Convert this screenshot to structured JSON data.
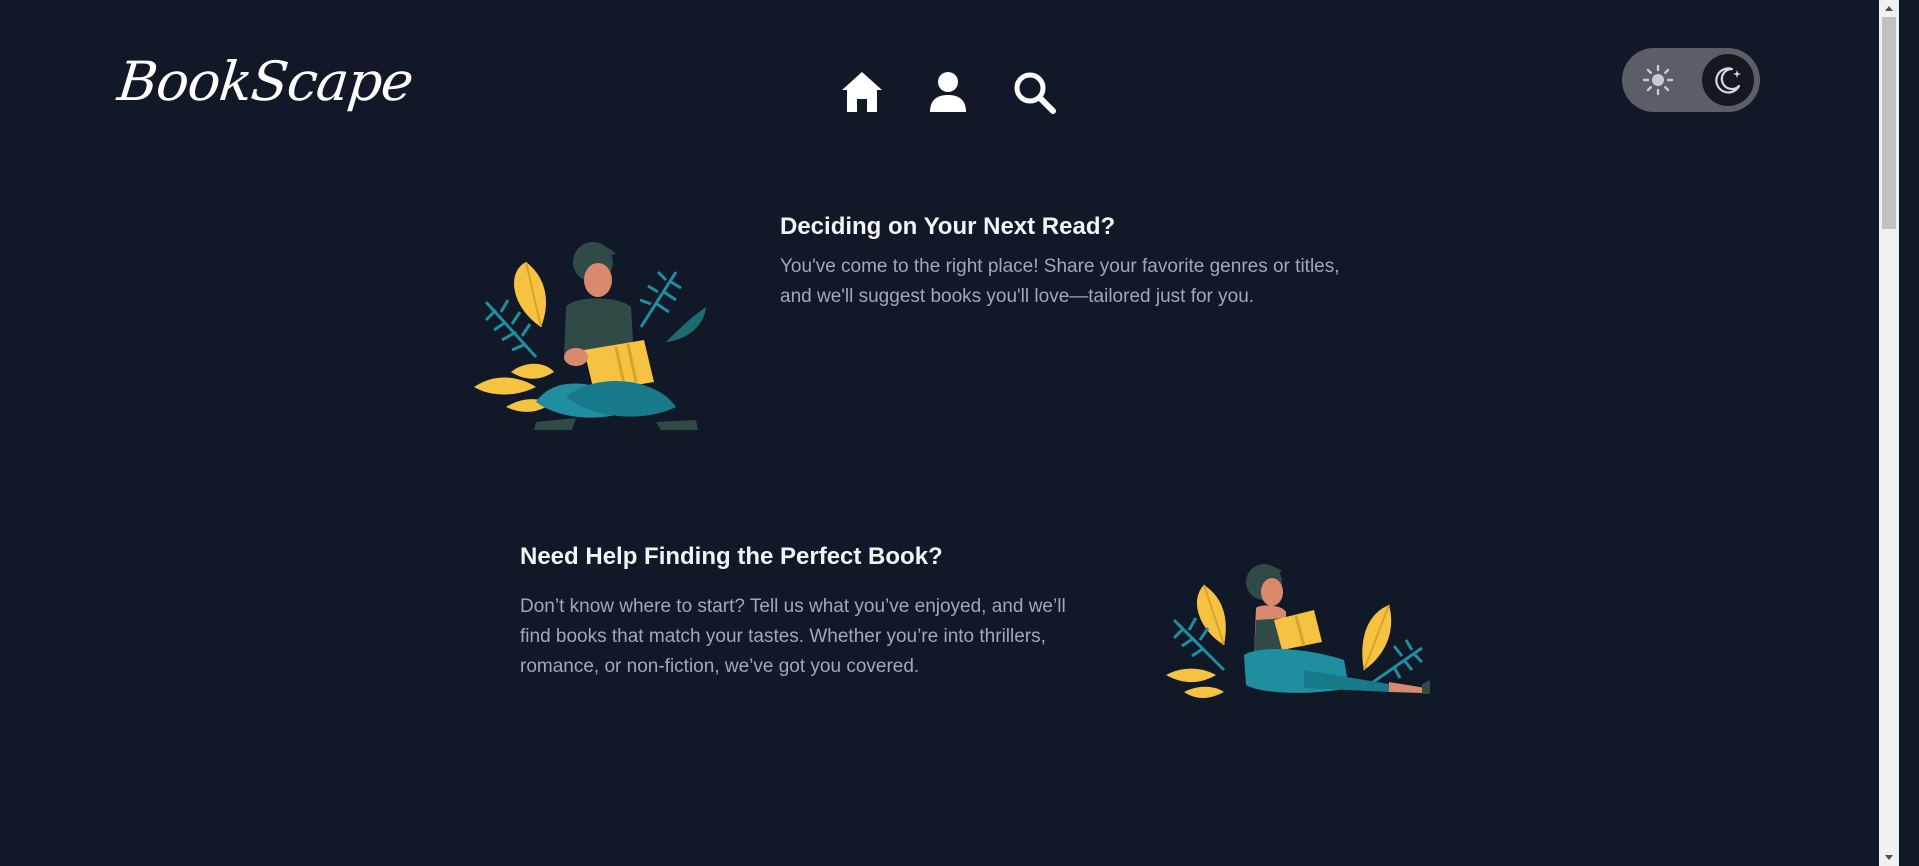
{
  "header": {
    "logo": "BookScape",
    "nav": [
      {
        "name": "home",
        "icon": "home-icon"
      },
      {
        "name": "profile",
        "icon": "user-icon"
      },
      {
        "name": "search",
        "icon": "search-icon"
      }
    ],
    "theme_toggle": {
      "light_icon": "sun-icon",
      "dark_icon": "moon-icon",
      "mode": "dark"
    }
  },
  "sections": [
    {
      "title": "Deciding on Your Next Read?",
      "lines": [
        "You've come to the right place! Share your favorite genres or titles,",
        "and we'll suggest books you'll love—tailored just for you."
      ]
    },
    {
      "title": "Need Help Finding the Perfect Book?",
      "lines": [
        "Don’t know where to start? Tell us what you’ve enjoyed, and we’ll",
        "find books that match your tastes. Whether you’re into thrillers,",
        "romance, or non-fiction, we’ve got you covered."
      ]
    }
  ],
  "colors": {
    "background": "#111827",
    "heading": "#f3f4f6",
    "body": "#a3a8b3",
    "toggle_track": "#5b5e66",
    "teal": "#1c8a99",
    "yellow": "#f5c242",
    "skin": "#d98a6e",
    "dark_green": "#2f4a47"
  }
}
